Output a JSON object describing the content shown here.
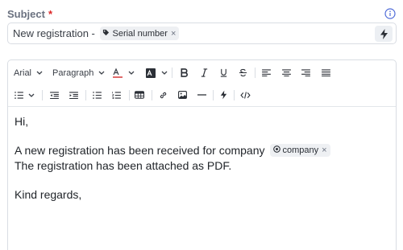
{
  "subject": {
    "label": "Subject",
    "required_mark": "*",
    "text_prefix": "New registration - ",
    "variable_chip": "Serial number",
    "chip_close": "×"
  },
  "toolbar": {
    "font_family": "Arial",
    "block_type": "Paragraph"
  },
  "body": {
    "greeting": "Hi,",
    "line1_text": "A new registration has been received for company",
    "line1_chip": "company",
    "chip_close": "×",
    "line2": "The registration has been attached as PDF.",
    "closing": "Kind regards,"
  },
  "colors": {
    "required": "#dc2626",
    "info_icon": "#4f6bd8",
    "border": "#d9dde3",
    "chip_bg": "#eef0f3"
  },
  "icons": [
    "info-icon",
    "tag-icon",
    "close-icon",
    "bolt-icon",
    "chevron-down-icon",
    "text-color-icon",
    "highlight-icon",
    "bold-icon",
    "italic-icon",
    "underline-icon",
    "strikethrough-icon",
    "align-left-icon",
    "align-center-icon",
    "align-right-icon",
    "align-justify-icon",
    "list-style-icon",
    "outdent-icon",
    "indent-icon",
    "bullet-list-icon",
    "numbered-list-icon",
    "table-icon",
    "link-icon",
    "image-icon",
    "horizontal-rule-icon",
    "code-icon",
    "variable-icon"
  ]
}
